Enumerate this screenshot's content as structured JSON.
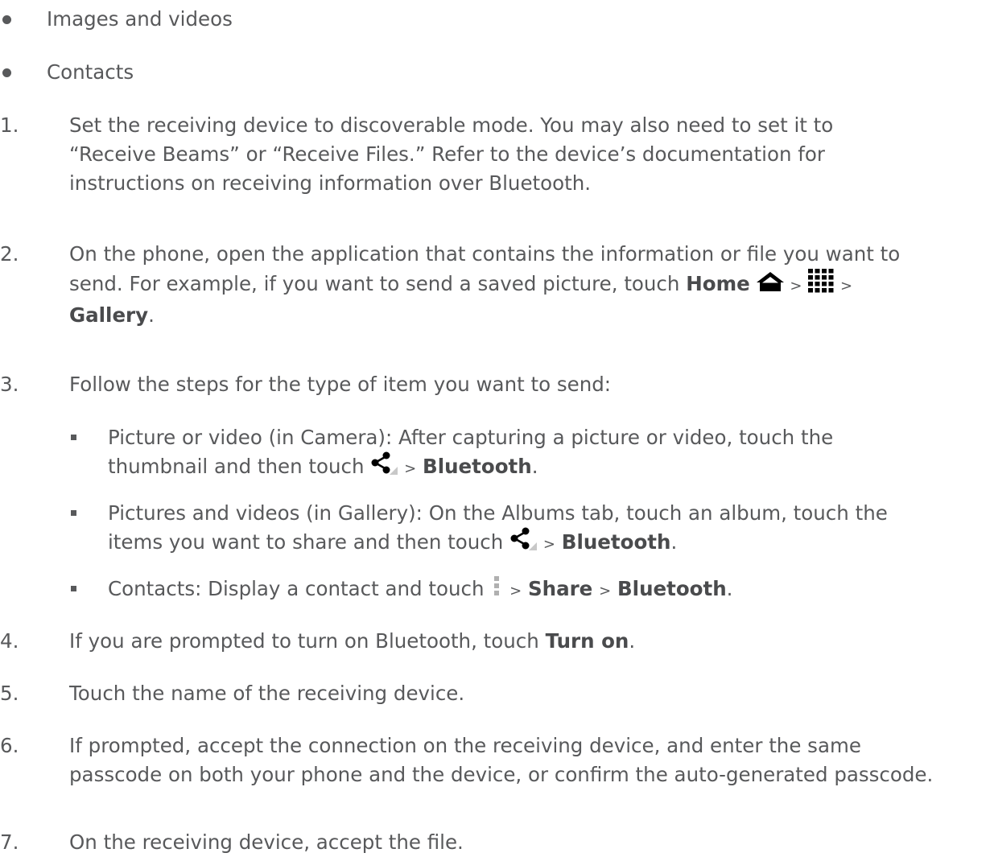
{
  "bullets": [
    {
      "text": "Images and videos"
    },
    {
      "text": "Contacts"
    }
  ],
  "steps": [
    {
      "number": "1.",
      "lines": [
        "Set the receiving device to discoverable mode. You may also need to set it to",
        "“Receive Beams” or “Receive Files.” Refer to the device’s documentation for",
        "instructions on receiving information over Bluetooth."
      ]
    },
    {
      "number": "2.",
      "line1": "On the phone, open the application that contains the information or file you want to",
      "line2_text": "send. For example, if you want to send a saved picture, touch ",
      "home": "Home",
      "gt": ">",
      "gallery": "Gallery",
      "period": "."
    },
    {
      "number": "3.",
      "text": "Follow the steps for the type of item you want to send:",
      "substeps": [
        {
          "line1": "Picture or video (in Camera): After capturing a picture or video, touch the",
          "line2_text": "thumbnail and then touch ",
          "gt": ">",
          "bold": "Bluetooth",
          "period": "."
        },
        {
          "line1": "Pictures and videos (in Gallery): On the Albums tab, touch an album, touch the",
          "line2_text": "items you want to share and then touch ",
          "gt": ">",
          "bold": "Bluetooth",
          "period": "."
        },
        {
          "text": "Contacts: Display a contact and touch ",
          "gt1": ">",
          "share": "Share",
          "gt2": ">",
          "bold": "Bluetooth",
          "period": "."
        }
      ]
    },
    {
      "number": "4.",
      "text": "If you are prompted to turn on Bluetooth, touch ",
      "bold": "Turn on",
      "period": "."
    },
    {
      "number": "5.",
      "text": "Touch the name of the receiving device."
    },
    {
      "number": "6.",
      "lines": [
        "If prompted, accept the connection on the receiving device, and enter the same",
        "passcode on both your phone and the device, or confirm the auto-generated passcode."
      ]
    },
    {
      "number": "7.",
      "text": "On the receiving device, accept the file."
    }
  ],
  "icons": {
    "home": "home-icon",
    "apps": "apps-grid-icon",
    "share": "share-icon",
    "menu": "menu-icon"
  },
  "colors": {
    "text": "#58595b",
    "icon": "#000000",
    "menu_icon": "#b0b0b0"
  }
}
